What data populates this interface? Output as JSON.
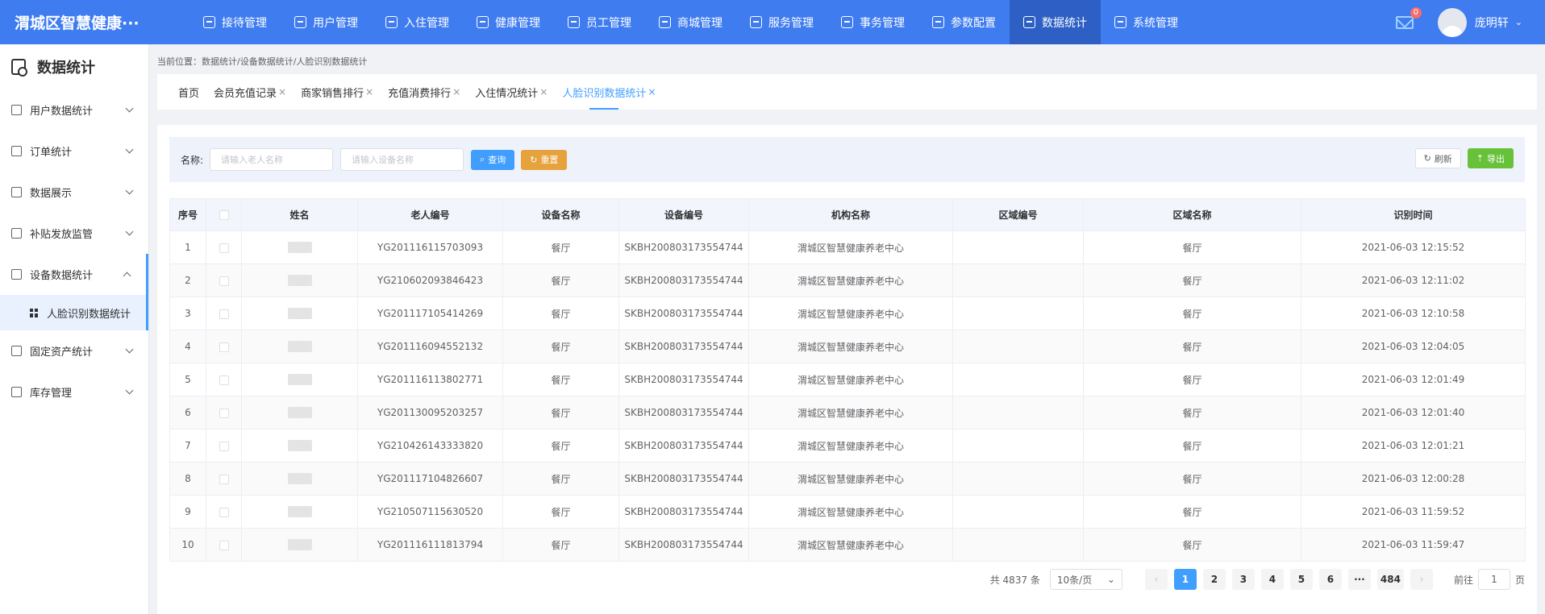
{
  "app": {
    "title": "渭城区智慧健康···"
  },
  "topnav": [
    {
      "label": "接待管理",
      "icon": "reception-icon"
    },
    {
      "label": "用户管理",
      "icon": "users-icon"
    },
    {
      "label": "入住管理",
      "icon": "checkin-icon"
    },
    {
      "label": "健康管理",
      "icon": "health-icon"
    },
    {
      "label": "员工管理",
      "icon": "staff-icon"
    },
    {
      "label": "商城管理",
      "icon": "shop-icon"
    },
    {
      "label": "服务管理",
      "icon": "service-icon"
    },
    {
      "label": "事务管理",
      "icon": "folder-icon"
    },
    {
      "label": "参数配置",
      "icon": "config-icon"
    },
    {
      "label": "数据统计",
      "icon": "stats-icon"
    },
    {
      "label": "系统管理",
      "icon": "system-icon"
    }
  ],
  "header": {
    "mail_badge": "0",
    "username": "庞明轩"
  },
  "sidebar": {
    "title": "数据统计",
    "items": [
      {
        "label": "用户数据统计"
      },
      {
        "label": "订单统计"
      },
      {
        "label": "数据展示"
      },
      {
        "label": "补贴发放监管"
      },
      {
        "label": "设备数据统计"
      },
      {
        "label": "人脸识别数据统计"
      },
      {
        "label": "固定资产统计"
      },
      {
        "label": "库存管理"
      }
    ]
  },
  "breadcrumb": "当前位置：数据统计/设备数据统计/人脸识别数据统计",
  "tabs": [
    "首页",
    "会员充值记录",
    "商家销售排行",
    "充值消费排行",
    "入住情况统计",
    "人脸识别数据统计"
  ],
  "tab_close": "×",
  "filter": {
    "label": "名称:",
    "name_placeholder": "请输入老人名称",
    "device_placeholder": "请输入设备名称",
    "search_btn": "查询",
    "reset_btn": "重置",
    "refresh_btn": "刷新",
    "export_btn": "导出"
  },
  "table": {
    "headers": [
      "序号",
      "",
      "姓名",
      "老人编号",
      "设备名称",
      "设备编号",
      "机构名称",
      "区域编号",
      "区域名称",
      "识别时间"
    ],
    "rows": [
      {
        "no": "1",
        "elder_id": "YG201116115703093",
        "device": "餐厅",
        "device_no": "SKBH200803173554744",
        "org": "渭城区智慧健康养老中心",
        "area_no": "",
        "area": "餐厅",
        "time": "2021-06-03 12:15:52"
      },
      {
        "no": "2",
        "elder_id": "YG210602093846423",
        "device": "餐厅",
        "device_no": "SKBH200803173554744",
        "org": "渭城区智慧健康养老中心",
        "area_no": "",
        "area": "餐厅",
        "time": "2021-06-03 12:11:02"
      },
      {
        "no": "3",
        "elder_id": "YG201117105414269",
        "device": "餐厅",
        "device_no": "SKBH200803173554744",
        "org": "渭城区智慧健康养老中心",
        "area_no": "",
        "area": "餐厅",
        "time": "2021-06-03 12:10:58"
      },
      {
        "no": "4",
        "elder_id": "YG201116094552132",
        "device": "餐厅",
        "device_no": "SKBH200803173554744",
        "org": "渭城区智慧健康养老中心",
        "area_no": "",
        "area": "餐厅",
        "time": "2021-06-03 12:04:05"
      },
      {
        "no": "5",
        "elder_id": "YG201116113802771",
        "device": "餐厅",
        "device_no": "SKBH200803173554744",
        "org": "渭城区智慧健康养老中心",
        "area_no": "",
        "area": "餐厅",
        "time": "2021-06-03 12:01:49"
      },
      {
        "no": "6",
        "elder_id": "YG201130095203257",
        "device": "餐厅",
        "device_no": "SKBH200803173554744",
        "org": "渭城区智慧健康养老中心",
        "area_no": "",
        "area": "餐厅",
        "time": "2021-06-03 12:01:40"
      },
      {
        "no": "7",
        "elder_id": "YG210426143333820",
        "device": "餐厅",
        "device_no": "SKBH200803173554744",
        "org": "渭城区智慧健康养老中心",
        "area_no": "",
        "area": "餐厅",
        "time": "2021-06-03 12:01:21"
      },
      {
        "no": "8",
        "elder_id": "YG201117104826607",
        "device": "餐厅",
        "device_no": "SKBH200803173554744",
        "org": "渭城区智慧健康养老中心",
        "area_no": "",
        "area": "餐厅",
        "time": "2021-06-03 12:00:28"
      },
      {
        "no": "9",
        "elder_id": "YG210507115630520",
        "device": "餐厅",
        "device_no": "SKBH200803173554744",
        "org": "渭城区智慧健康养老中心",
        "area_no": "",
        "area": "餐厅",
        "time": "2021-06-03 11:59:52"
      },
      {
        "no": "10",
        "elder_id": "YG201116111813794",
        "device": "餐厅",
        "device_no": "SKBH200803173554744",
        "org": "渭城区智慧健康养老中心",
        "area_no": "",
        "area": "餐厅",
        "time": "2021-06-03 11:59:47"
      }
    ]
  },
  "pagination": {
    "total": "共 4837 条",
    "page_size": "10条/页",
    "pages": [
      "1",
      "2",
      "3",
      "4",
      "5",
      "6",
      "···",
      "484"
    ],
    "current": "1",
    "goto_label": "前往",
    "goto_value": "1",
    "goto_suffix": "页"
  },
  "colors": {
    "primary": "#3f7cf0",
    "active_nav": "#2d5fc4",
    "accent": "#409eff",
    "warn": "#e6a23c",
    "success": "#67c23a"
  }
}
